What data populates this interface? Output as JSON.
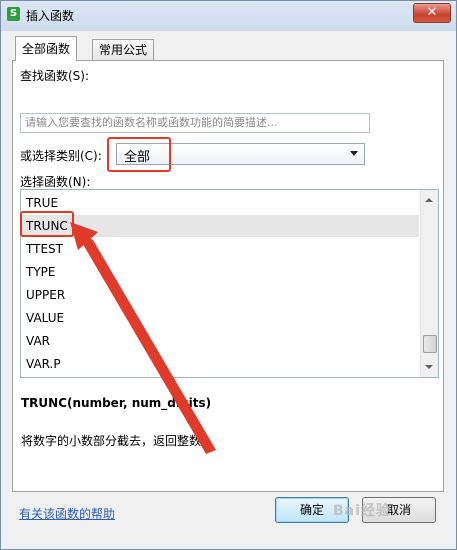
{
  "window": {
    "title": "插入函数",
    "app_icon_glyph": "S",
    "close_glyph": "✕"
  },
  "tabs": [
    {
      "label": "全部函数",
      "active": true
    },
    {
      "label": "常用公式",
      "active": false
    }
  ],
  "search": {
    "label": "查找函数(S):",
    "placeholder": "请输入您要查找的函数名称或函数功能的简要描述..."
  },
  "category": {
    "label": "或选择类别(C):",
    "value": "全部"
  },
  "functions": {
    "label": "选择函数(N):",
    "items": [
      "TRUE",
      "TRUNC",
      "TTEST",
      "TYPE",
      "UPPER",
      "VALUE",
      "VAR",
      "VAR.P"
    ],
    "selected": "TRUNC"
  },
  "selected_function": {
    "signature": "TRUNC(number, num_digits)",
    "description": "将数字的小数部分截去，返回整数。"
  },
  "help_link": "有关该函数的帮助",
  "buttons": {
    "ok": "确定",
    "cancel": "取消"
  },
  "watermark": "Bai经验",
  "colors": {
    "annotation_red": "#e03a2a",
    "link_blue": "#2a5cb8"
  }
}
